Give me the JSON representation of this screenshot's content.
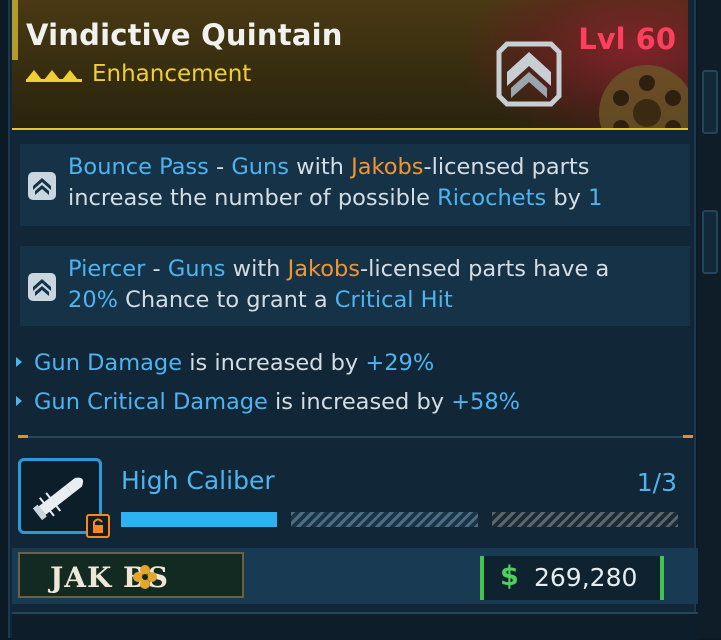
{
  "item": {
    "name": "Vindictive Quintain",
    "type": "Enhancement",
    "level": "Lvl 60",
    "class_icon": "chevron-emblem-icon",
    "rarity_color": "#e6c52a",
    "level_color": "#ff3f5e"
  },
  "perks": [
    {
      "icon": "perk-chevron-icon",
      "name": "Bounce Pass",
      "sep": " - ",
      "p1": "Guns",
      "p2": " with ",
      "maker": "Jakobs",
      "p3": "-licensed parts",
      "p4": "increase the number of possible ",
      "p5": "Ricochets",
      "p6": " by ",
      "p7": "1"
    },
    {
      "icon": "perk-chevron-icon",
      "name": "Piercer",
      "sep": " - ",
      "p1": "Guns",
      "p2": " with ",
      "maker": "Jakobs",
      "p3": "-licensed parts have a",
      "p4": "20%",
      "p5": " Chance to grant a ",
      "p6": "Critical Hit"
    }
  ],
  "stats": [
    {
      "label": "Gun Damage",
      "mid": " is increased by ",
      "value": "+29%"
    },
    {
      "label": "Gun Critical Damage",
      "mid": " is increased by ",
      "value": "+58%"
    }
  ],
  "challenge": {
    "title": "High Caliber",
    "progress_text": "1/3",
    "progress_fraction": 0.333,
    "icon": "bullet-icon",
    "lock_icon": "lock-icon"
  },
  "manufacturer": {
    "logo_text": "JAK  BS",
    "logo_icon": "jakobs-flower-icon"
  },
  "price": {
    "currency_symbol": "$",
    "value": "269,280"
  },
  "colors": {
    "blue": "#4eb4f0",
    "orange": "#f29531",
    "green": "#44c34e"
  }
}
